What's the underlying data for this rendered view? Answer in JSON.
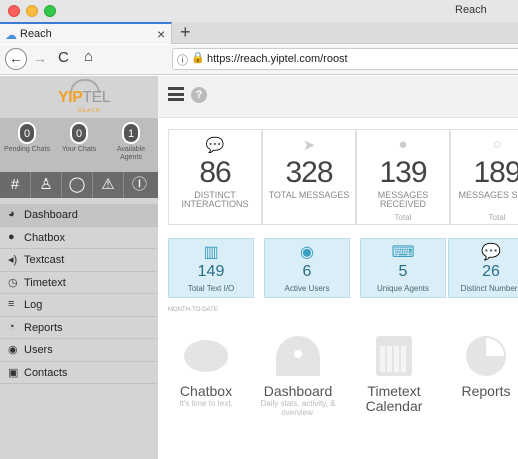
{
  "window": {
    "title": "Reach"
  },
  "tab": {
    "label": "Reach",
    "close": "×",
    "new": "+"
  },
  "nav": {
    "back": "←",
    "forward": "→",
    "reload": "C",
    "home": "⌂",
    "url": "https://reach.yiptel.com/roost"
  },
  "logo": {
    "yip": "YIP",
    "tel": "TEL",
    "sub": "REACH"
  },
  "sidebar_stats": [
    {
      "value": "0",
      "label": "Pending Chats"
    },
    {
      "value": "0",
      "label": "Your Chats"
    },
    {
      "value": "1",
      "label": "Available Agents"
    }
  ],
  "sidebar_icons": [
    "#",
    "user",
    "bubble",
    "warning",
    "pause"
  ],
  "menu": [
    {
      "label": "Dashboard",
      "icon": "dashboard-icon"
    },
    {
      "label": "Chatbox",
      "icon": "chat-icon"
    },
    {
      "label": "Textcast",
      "icon": "broadcast-icon"
    },
    {
      "label": "Timetext",
      "icon": "clock-icon"
    },
    {
      "label": "Log",
      "icon": "list-icon"
    },
    {
      "label": "Reports",
      "icon": "pie-icon"
    },
    {
      "label": "Users",
      "icon": "user-icon"
    },
    {
      "label": "Contacts",
      "icon": "contacts-icon"
    }
  ],
  "cards": [
    {
      "value": "86",
      "label": "DISTINCT INTERACTIONS",
      "sub": ""
    },
    {
      "value": "328",
      "label": "TOTAL MESSAGES",
      "sub": ""
    },
    {
      "value": "139",
      "label": "MESSAGES RECEIVED",
      "sub": "Total"
    },
    {
      "value": "189",
      "label": "MESSAGES SENT",
      "sub": "Total"
    }
  ],
  "blue_cards": [
    {
      "value": "149",
      "label": "Total Text I/O"
    },
    {
      "value": "6",
      "label": "Active Users"
    },
    {
      "value": "5",
      "label": "Unique Agents"
    },
    {
      "value": "26",
      "label": "Distinct Numbers"
    }
  ],
  "month_to_date": "MONTH-TO-DATE",
  "shortcuts": [
    {
      "title": "Chatbox",
      "desc": "It's time to text."
    },
    {
      "title": "Dashboard",
      "desc": "Daily stats, activity, & overview."
    },
    {
      "title": "Timetext Calendar",
      "desc": ""
    },
    {
      "title": "Reports",
      "desc": ""
    }
  ],
  "colors": {
    "accent_orange": "#f0a22a",
    "sidebar_bg": "#d4d4d4",
    "blue_card_bg": "#d9eef6"
  }
}
